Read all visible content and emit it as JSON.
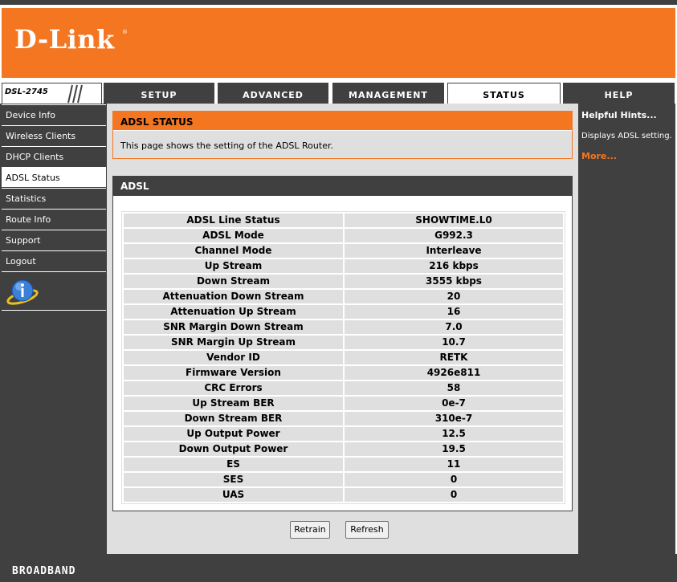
{
  "brand": {
    "logo": "D-Link",
    "registered": "®",
    "model": "DSL-2745",
    "footer": "BROADBAND"
  },
  "colors": {
    "accent": "#f47621",
    "dark": "#404040",
    "panel": "#dfdfdf"
  },
  "nav": {
    "tabs": [
      "SETUP",
      "ADVANCED",
      "MANAGEMENT",
      "STATUS",
      "HELP"
    ],
    "active": "STATUS"
  },
  "sidebar": {
    "items": [
      "Device Info",
      "Wireless Clients",
      "DHCP Clients",
      "ADSL Status",
      "Statistics",
      "Route Info",
      "Support",
      "Logout"
    ],
    "active": "ADSL Status",
    "icon": "info-icon"
  },
  "status": {
    "title": "ADSL STATUS",
    "description": "This page shows the setting of the ADSL Router."
  },
  "adsl": {
    "title": "ADSL",
    "rows": [
      {
        "label": "ADSL Line Status",
        "value": "SHOWTIME.L0"
      },
      {
        "label": "ADSL Mode",
        "value": "G992.3"
      },
      {
        "label": "Channel Mode",
        "value": "Interleave"
      },
      {
        "label": "Up Stream",
        "value": "216 kbps"
      },
      {
        "label": "Down Stream",
        "value": "3555 kbps"
      },
      {
        "label": "Attenuation Down Stream",
        "value": "20"
      },
      {
        "label": "Attenuation Up Stream",
        "value": "16"
      },
      {
        "label": "SNR Margin Down Stream",
        "value": "7.0"
      },
      {
        "label": "SNR Margin Up Stream",
        "value": "10.7"
      },
      {
        "label": "Vendor ID",
        "value": "RETK"
      },
      {
        "label": "Firmware Version",
        "value": "4926e811"
      },
      {
        "label": "CRC Errors",
        "value": "58"
      },
      {
        "label": "Up Stream BER",
        "value": "0e-7"
      },
      {
        "label": "Down Stream BER",
        "value": "310e-7"
      },
      {
        "label": "Up Output Power",
        "value": "12.5"
      },
      {
        "label": "Down Output Power",
        "value": "19.5"
      },
      {
        "label": "ES",
        "value": "11"
      },
      {
        "label": "SES",
        "value": "0"
      },
      {
        "label": "UAS",
        "value": "0"
      }
    ]
  },
  "buttons": {
    "retrain": "Retrain",
    "refresh": "Refresh"
  },
  "hints": {
    "title": "Helpful Hints...",
    "text": "Displays ADSL setting.",
    "more": "More..."
  }
}
